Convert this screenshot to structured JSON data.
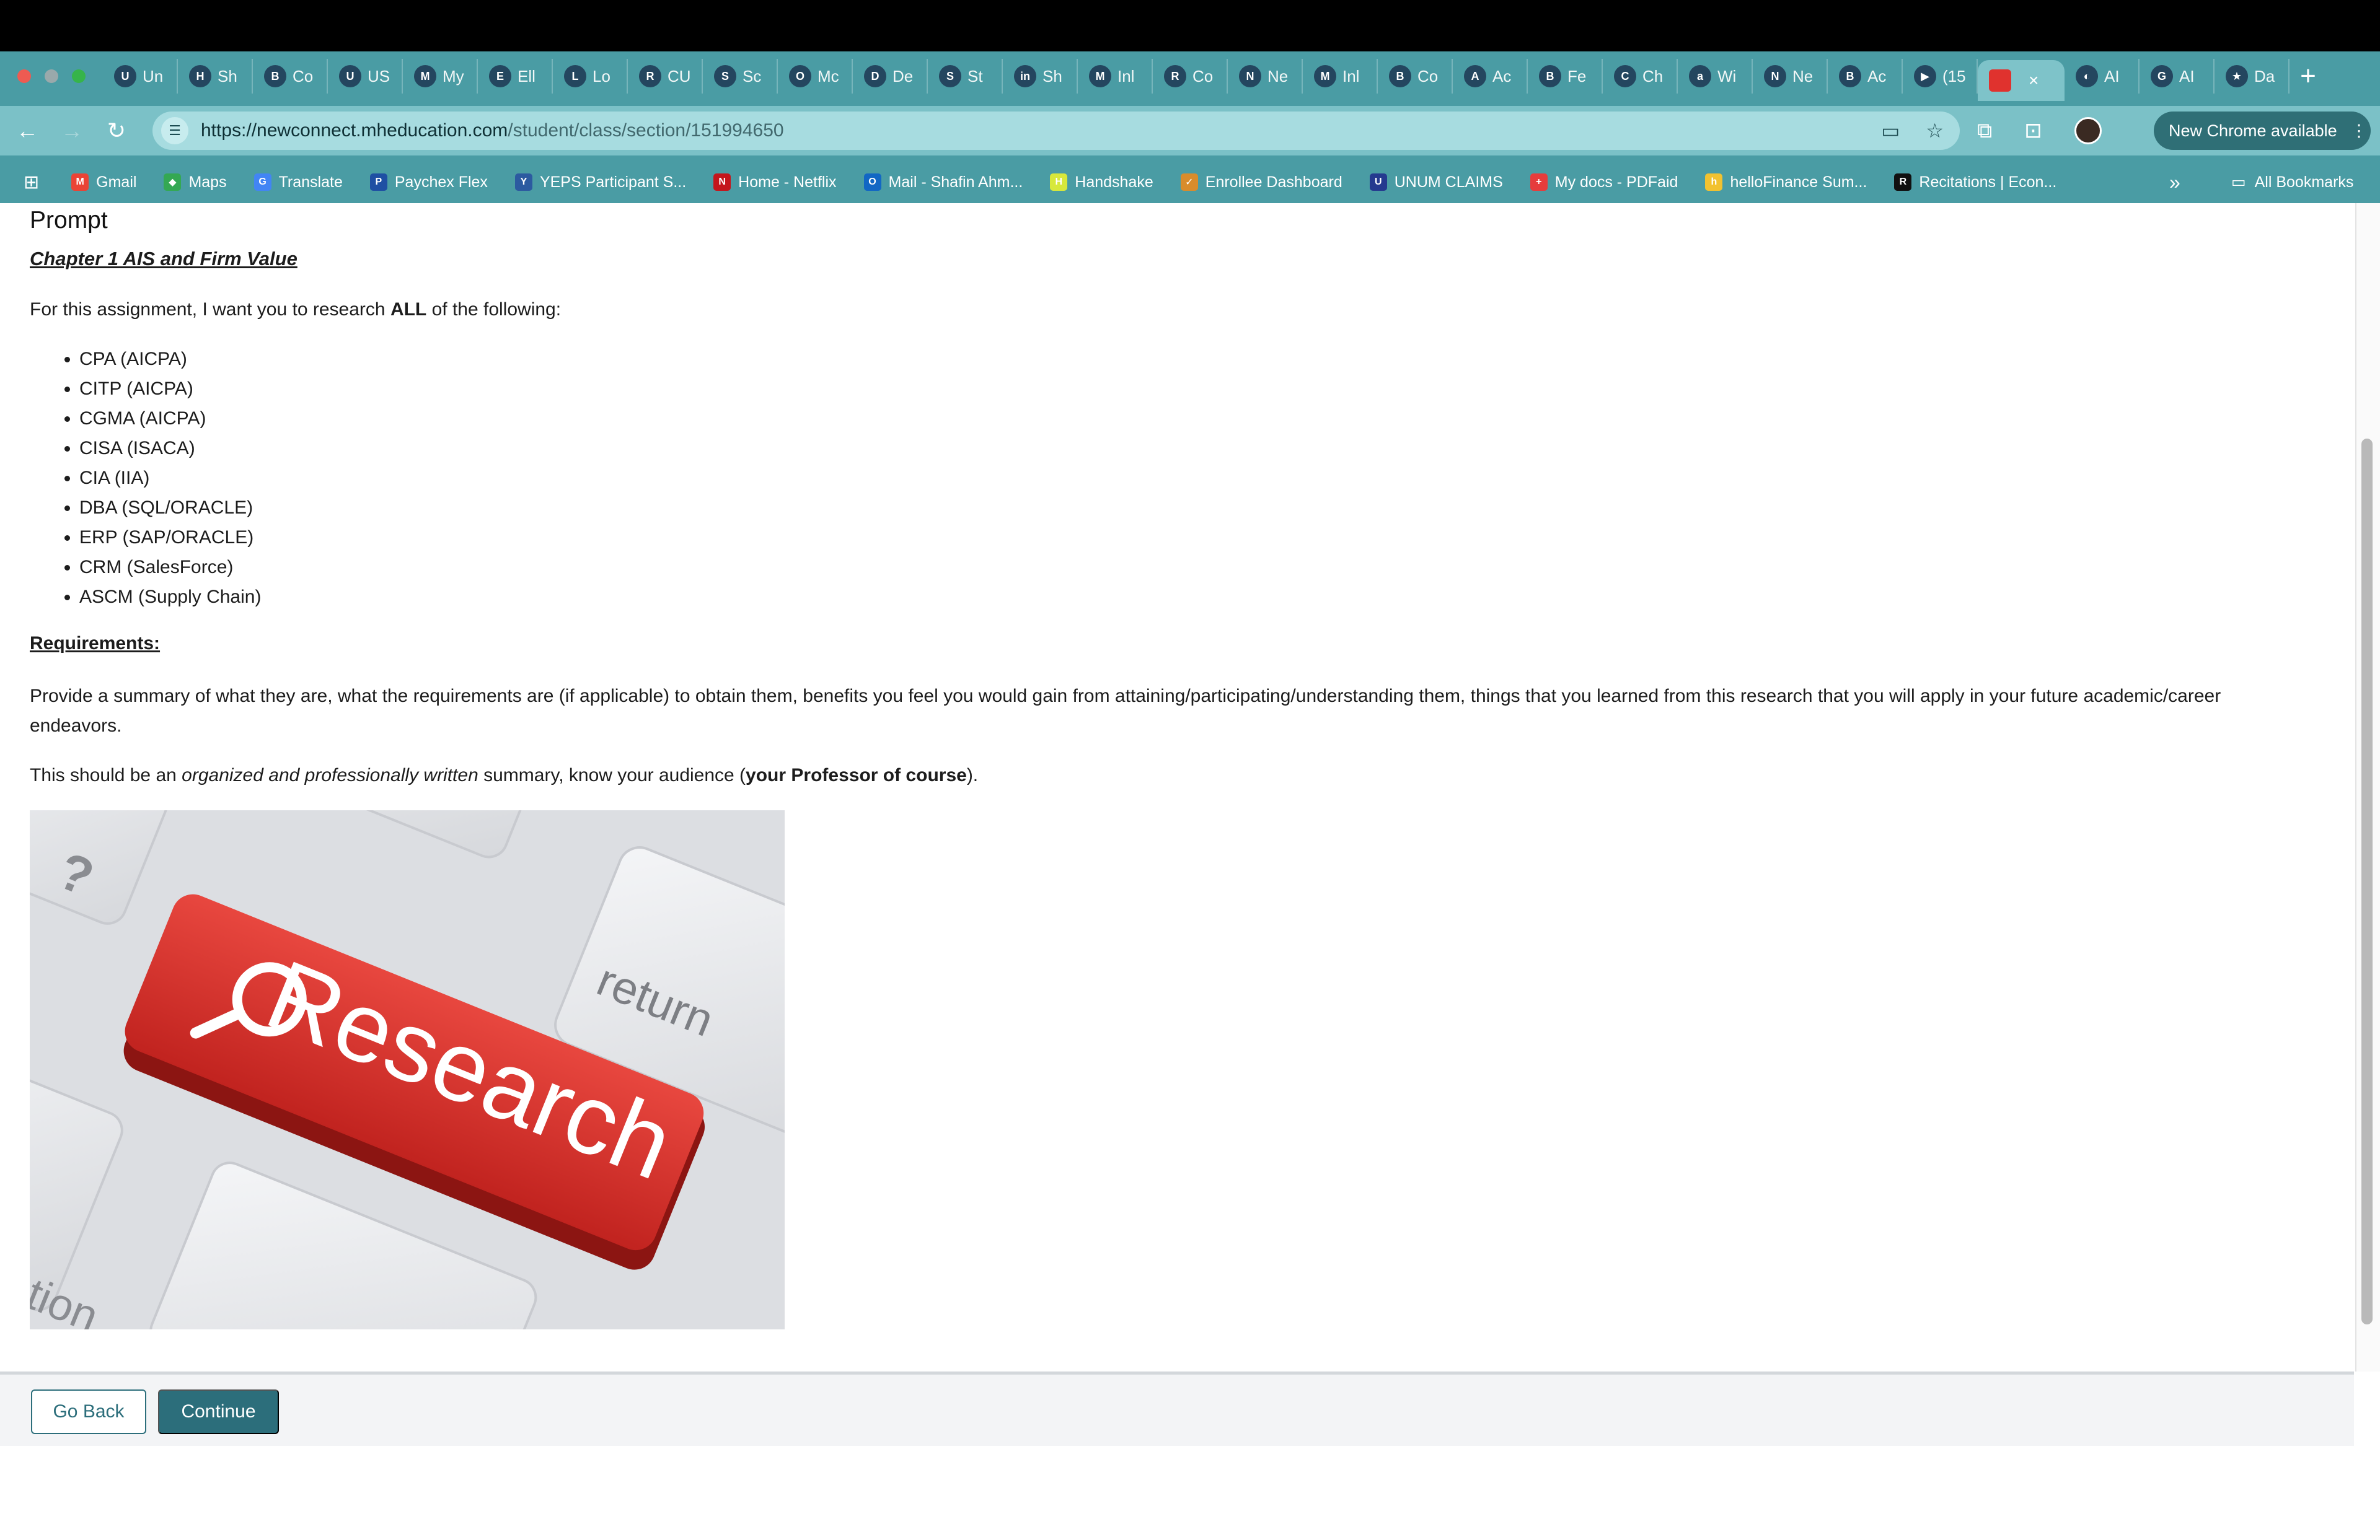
{
  "browser": {
    "tabs": [
      {
        "label": "Un",
        "fav": "U"
      },
      {
        "label": "Sh",
        "fav": "H"
      },
      {
        "label": "Co",
        "fav": "B"
      },
      {
        "label": "US",
        "fav": "U"
      },
      {
        "label": "My",
        "fav": "M"
      },
      {
        "label": "Ell",
        "fav": "E"
      },
      {
        "label": "Lo",
        "fav": "L"
      },
      {
        "label": "CU",
        "fav": "R"
      },
      {
        "label": "Sc",
        "fav": "S"
      },
      {
        "label": "Mc",
        "fav": "O"
      },
      {
        "label": "De",
        "fav": "D"
      },
      {
        "label": "St",
        "fav": "S"
      },
      {
        "label": "Sh",
        "fav": "in"
      },
      {
        "label": "Inl",
        "fav": "M"
      },
      {
        "label": "Co",
        "fav": "R"
      },
      {
        "label": "Ne",
        "fav": "N"
      },
      {
        "label": "Inl",
        "fav": "M"
      },
      {
        "label": "Co",
        "fav": "B"
      },
      {
        "label": "Ac",
        "fav": "A"
      },
      {
        "label": "Fe",
        "fav": "B"
      },
      {
        "label": "Ch",
        "fav": "C"
      },
      {
        "label": "Wi",
        "fav": "a"
      },
      {
        "label": "Ne",
        "fav": "N"
      },
      {
        "label": "Ac",
        "fav": "B"
      },
      {
        "label": "(15",
        "fav": "▶"
      }
    ],
    "active_tab_close": "×",
    "tabs_after": [
      {
        "label": "AI",
        "fav": "◐"
      },
      {
        "label": "AI",
        "fav": "G"
      },
      {
        "label": "Da",
        "fav": "★"
      }
    ],
    "new_tab": "+",
    "url_host": "https://newconnect.mheducation.com",
    "url_path": "/student/class/section/151994650",
    "update_label": "New Chrome available",
    "bookmarks": [
      {
        "label": "Gmail",
        "color": "#ea4335",
        "glyph": "M"
      },
      {
        "label": "Maps",
        "color": "#34a853",
        "glyph": "◆"
      },
      {
        "label": "Translate",
        "color": "#4285f4",
        "glyph": "G"
      },
      {
        "label": "Paychex Flex",
        "color": "#1f4fa3",
        "glyph": "P"
      },
      {
        "label": "YEPS Participant S...",
        "color": "#2c5aa0",
        "glyph": "Y"
      },
      {
        "label": "Home - Netflix",
        "color": "#c4161c",
        "glyph": "N"
      },
      {
        "label": "Mail - Shafin Ahm...",
        "color": "#1267c4",
        "glyph": "O"
      },
      {
        "label": "Handshake",
        "color": "#d7e83b",
        "glyph": "H"
      },
      {
        "label": "Enrollee Dashboard",
        "color": "#d98c2b",
        "glyph": "✓"
      },
      {
        "label": "UNUM CLAIMS",
        "color": "#253a8f",
        "glyph": "U"
      },
      {
        "label": "My docs - PDFaid",
        "color": "#e63c3c",
        "glyph": "+"
      },
      {
        "label": "helloFinance Sum...",
        "color": "#f2c230",
        "glyph": "h"
      },
      {
        "label": "Recitations | Econ...",
        "color": "#111111",
        "glyph": "R"
      }
    ],
    "bookmarks_more": "»",
    "all_bookmarks": "All Bookmarks"
  },
  "page": {
    "heading": "Prompt",
    "chapter": "Chapter 1 AIS and Firm Value",
    "intro_before": "For this assignment, I want you to research ",
    "intro_bold": "ALL",
    "intro_after": " of the following:",
    "items": [
      "CPA (AICPA)",
      "CITP (AICPA)",
      "CGMA (AICPA)",
      "CISA (ISACA)",
      "CIA (IIA)",
      "DBA (SQL/ORACLE)",
      "ERP (SAP/ORACLE)",
      "CRM (SalesForce)",
      "ASCM (Supply Chain)"
    ],
    "requirements_label": "Requirements: ",
    "requirements_text": "Provide a summary of what they are, what the requirements are (if applicable) to obtain them, benefits you feel you would gain from attaining/participating/understanding them, things that you learned from this research that you will apply in your future academic/career endeavors.",
    "audience_1": "This should be an ",
    "audience_italic": "organized and professionally written",
    "audience_2": " summary, know your audience (",
    "audience_bold": "your Professor of course",
    "audience_3": ").",
    "image_key_label": "Research",
    "image_key_return": "return",
    "image_key_q": "?",
    "image_key_tion": "tion"
  },
  "footer": {
    "back_label": "Go Back",
    "continue_label": "Continue"
  },
  "colors": {
    "chrome_bg": "#4a9ca4",
    "button_teal": "#2c6e7b",
    "research_red": "#d8322e"
  }
}
